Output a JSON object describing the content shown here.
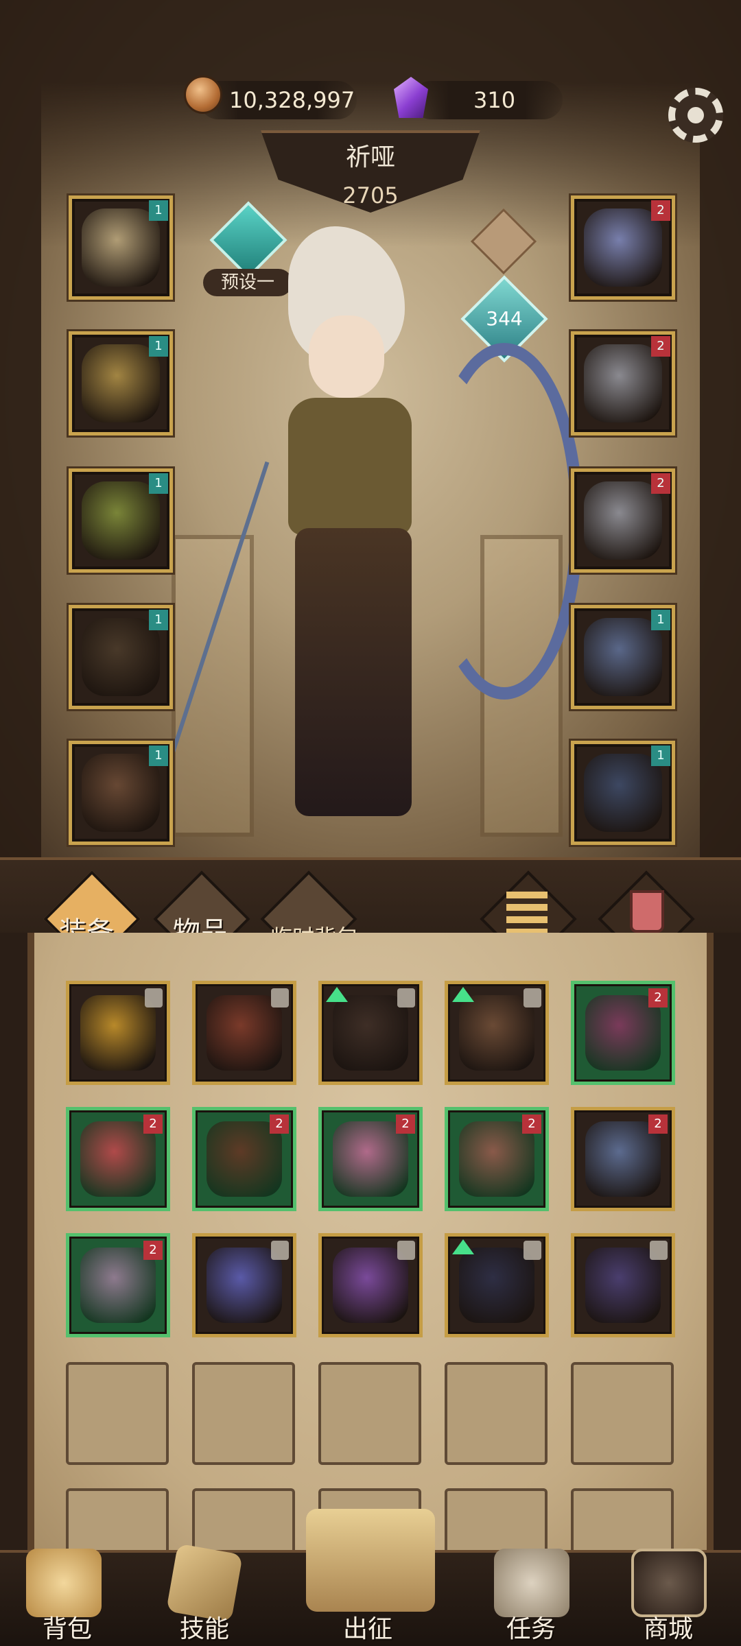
{
  "currency": {
    "gold": "10,328,997",
    "gems": "310"
  },
  "hero": {
    "name": "祈哑",
    "power": "2705",
    "preset": "预设一",
    "level": "344"
  },
  "equipment": {
    "left": [
      {
        "name": "wing-headpiece",
        "tier": "1",
        "color": "#b7a37a"
      },
      {
        "name": "gold-shoulder-armor",
        "tier": "1",
        "color": "#a88a45"
      },
      {
        "name": "leaf-gauntlet",
        "tier": "1",
        "color": "#7e8a3a"
      },
      {
        "name": "dark-leg-armor",
        "tier": "1",
        "color": "#4a3a2a"
      },
      {
        "name": "skull-boots",
        "tier": "1",
        "color": "#6a4a35"
      }
    ],
    "right": [
      {
        "name": "crystal-amulet",
        "tier": "2",
        "color": "#7c84b4"
      },
      {
        "name": "silver-ring-1",
        "tier": "2",
        "color": "#8f8f96"
      },
      {
        "name": "silver-ring-2",
        "tier": "2",
        "color": "#8f8f96"
      },
      {
        "name": "ornate-bow",
        "tier": "1",
        "color": "#5c6b8f"
      },
      {
        "name": "spiked-quiver",
        "tier": "1",
        "color": "#3e4a66"
      }
    ]
  },
  "tabs": {
    "equipment": "装备",
    "items": "物品",
    "temp_bag": "临时背包"
  },
  "inventory": [
    {
      "name": "gold-star-amulet",
      "green": false,
      "badge": "lock",
      "color": "#b8892a"
    },
    {
      "name": "red-longbow",
      "green": false,
      "badge": "lock",
      "color": "#7a3a2a"
    },
    {
      "name": "dark-belt-armor",
      "green": false,
      "badge": "lock-up",
      "color": "#3e2e26"
    },
    {
      "name": "leather-boots",
      "green": false,
      "badge": "lock-up",
      "color": "#6a4a35"
    },
    {
      "name": "crimson-horn-helm",
      "green": true,
      "badge": "rank",
      "color": "#7a3a5a"
    },
    {
      "name": "feather-cape-armor",
      "green": true,
      "badge": "rank",
      "color": "#b04a4a"
    },
    {
      "name": "leather-bracer",
      "green": true,
      "badge": "rank",
      "color": "#5e3a26"
    },
    {
      "name": "pink-fringe-skirt",
      "green": true,
      "badge": "rank",
      "color": "#b06a8a"
    },
    {
      "name": "claw-greaves",
      "green": true,
      "badge": "rank",
      "color": "#8a5a4a"
    },
    {
      "name": "steel-recurve-bow",
      "green": false,
      "badge": "rank",
      "color": "#5c6b8f"
    },
    {
      "name": "bone-dragon-skull",
      "green": true,
      "badge": "rank",
      "color": "#8e7a8e"
    },
    {
      "name": "blue-crystal-gauntlet",
      "green": false,
      "badge": "lock",
      "color": "#5a5aa8"
    },
    {
      "name": "violet-thorn-bracer",
      "green": false,
      "badge": "lock",
      "color": "#7a4a9a"
    },
    {
      "name": "shadow-cloak",
      "green": false,
      "badge": "lock-up",
      "color": "#2e2e44"
    },
    {
      "name": "purple-wolf-helm",
      "green": false,
      "badge": "lock",
      "color": "#4a3e6e"
    }
  ],
  "rank_text": "2",
  "nav": {
    "bag": "背包",
    "skills": "技能",
    "expedition": "出征",
    "quests": "任务",
    "shop": "商城"
  }
}
